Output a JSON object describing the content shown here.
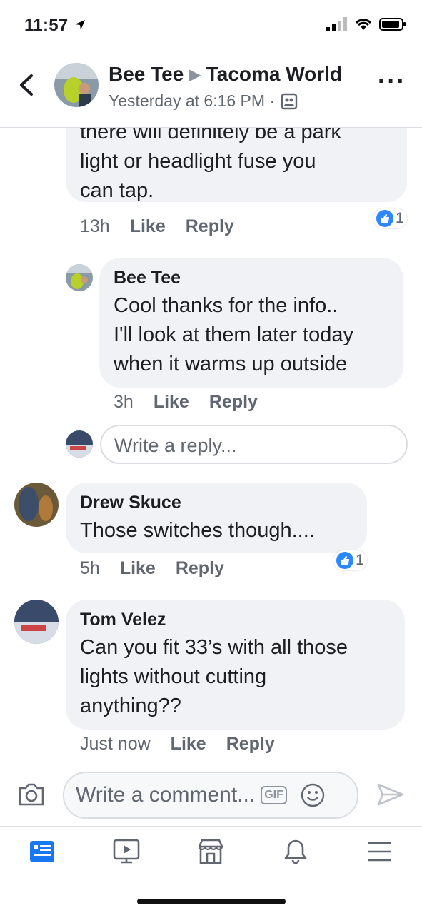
{
  "status": {
    "time": "11:57"
  },
  "header": {
    "author": "Bee Tee",
    "group": "Tacoma World",
    "timestamp": "Yesterday at 6:16 PM ·"
  },
  "comments": [
    {
      "text_lines": [
        "there will definitely be a park",
        "light or headlight fuse you",
        "can tap."
      ],
      "time": "13h",
      "like": "Like",
      "reply": "Reply",
      "reactions": "1"
    },
    {
      "name": "Bee Tee",
      "text_lines": [
        "Cool thanks for the info..",
        "I'll look at them later today",
        "when it warms up outside"
      ],
      "time": "3h",
      "like": "Like",
      "reply": "Reply"
    },
    {
      "name": "Drew Skuce",
      "text_lines": [
        "Those switches though...."
      ],
      "time": "5h",
      "like": "Like",
      "reply": "Reply",
      "reactions": "1"
    },
    {
      "name": "Tom Velez",
      "text_lines": [
        "Can you fit 33’s with all those",
        "lights without cutting",
        "anything??"
      ],
      "time": "Just now",
      "like": "Like",
      "reply": "Reply"
    }
  ],
  "reply_input": {
    "placeholder": "Write a reply..."
  },
  "comment_input": {
    "placeholder": "Write a comment...",
    "gif": "GIF"
  },
  "tabs": [
    "news-feed",
    "watch",
    "marketplace",
    "notifications",
    "menu"
  ],
  "colors": {
    "accent": "#1877f2",
    "bubble": "#f0f2f5",
    "meta": "#606770"
  }
}
